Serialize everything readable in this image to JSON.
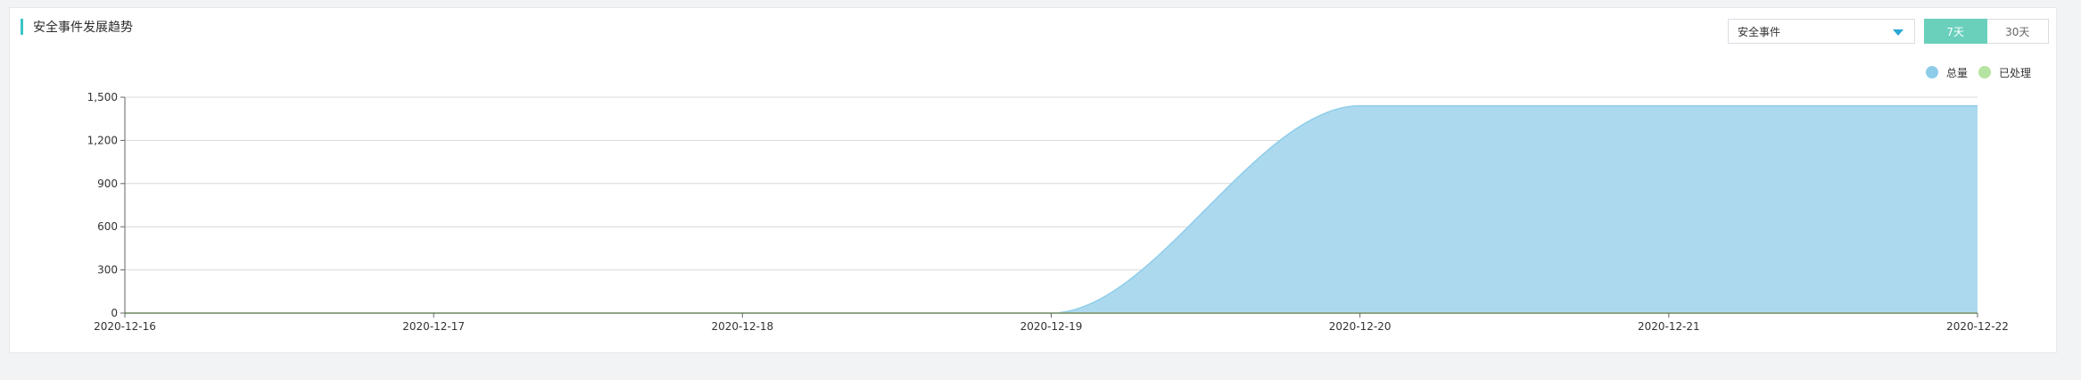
{
  "panel": {
    "title": "安全事件发展趋势",
    "select_value": "安全事件",
    "range_buttons": [
      {
        "label": "7天",
        "active": true
      },
      {
        "label": "30天",
        "active": false
      }
    ]
  },
  "colors": {
    "accent_bar": "#3bc4c4",
    "total_fill": "#add9ef",
    "total_line": "#8ecde9",
    "processed": "#b5e3a1",
    "active_button": "#6ad0bc"
  },
  "chart_data": {
    "type": "area",
    "x": [
      "2020-12-16",
      "2020-12-17",
      "2020-12-18",
      "2020-12-19",
      "2020-12-20",
      "2020-12-21",
      "2020-12-22"
    ],
    "ylim": [
      0,
      1500
    ],
    "yticks": [
      0,
      300,
      600,
      900,
      1200,
      1500
    ],
    "ytick_labels": [
      "0",
      "300",
      "600",
      "900",
      "1,200",
      "1,500"
    ],
    "legend_position": "top-right",
    "grid": true,
    "series": [
      {
        "name": "总量",
        "color": "#add9ef",
        "values": [
          0,
          0,
          0,
          0,
          1440,
          1440,
          1440
        ]
      },
      {
        "name": "已处理",
        "color": "#b5e3a1",
        "values": [
          0,
          0,
          0,
          0,
          0,
          0,
          0
        ]
      }
    ]
  }
}
